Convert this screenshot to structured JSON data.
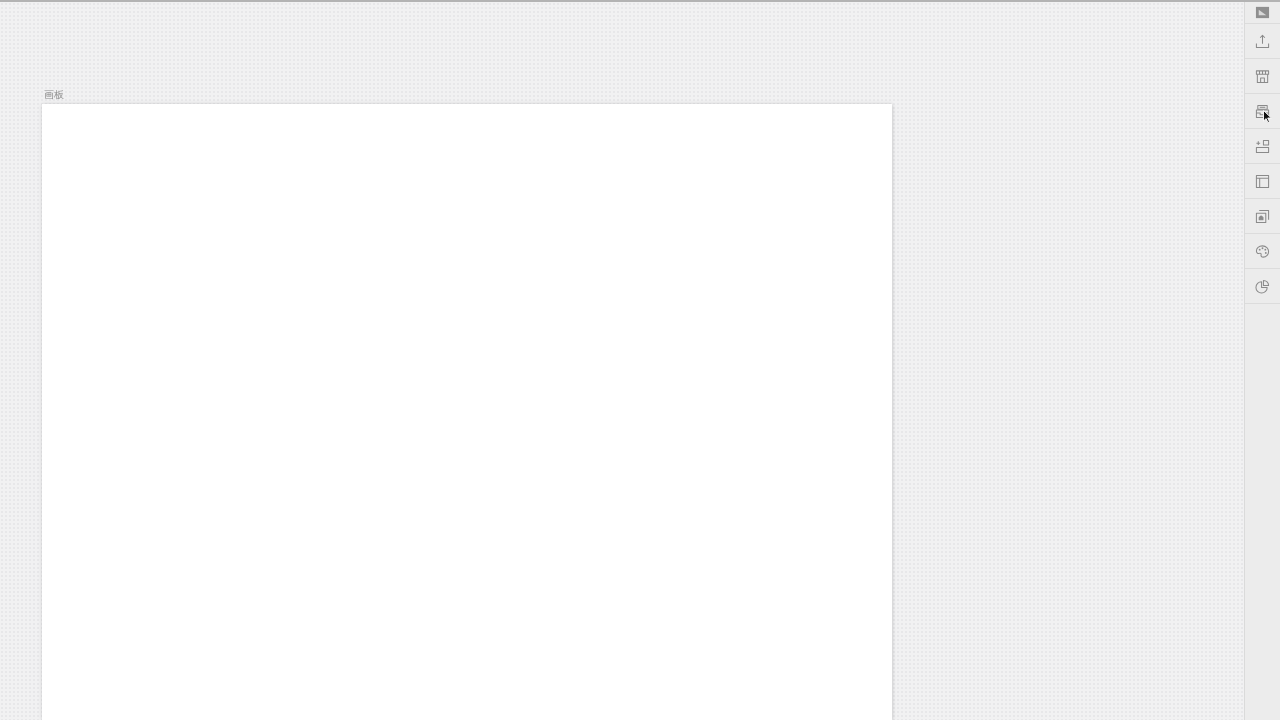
{
  "artboard": {
    "label": "画板"
  }
}
